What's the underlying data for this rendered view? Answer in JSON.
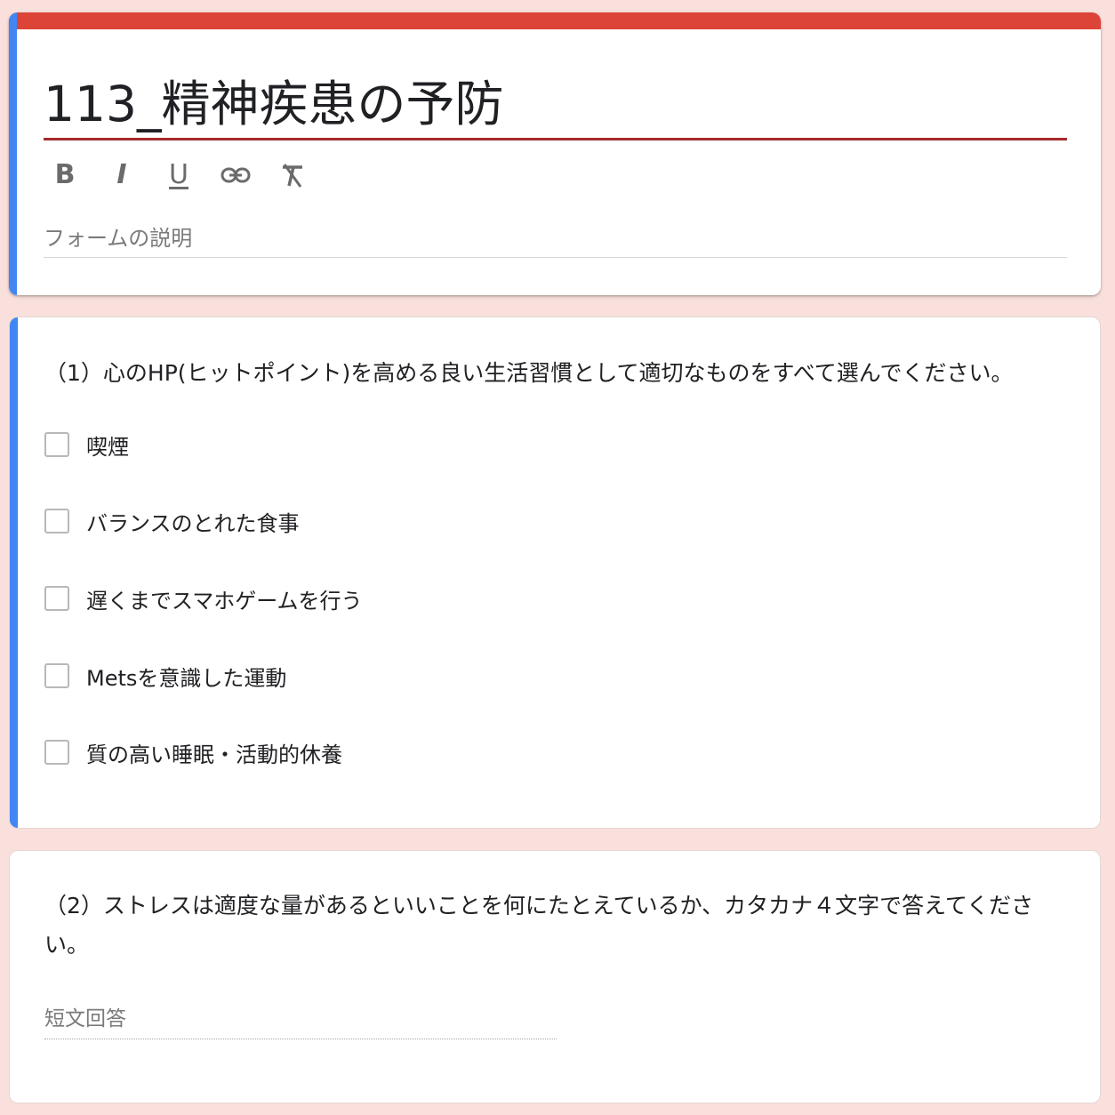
{
  "colors": {
    "background": "#fae0dc",
    "header_accent": "#db4437",
    "focus_accent": "#4285f4",
    "title_underline": "#a52a2a"
  },
  "form": {
    "title": "113_精神疾患の予防",
    "description_placeholder": "フォームの説明",
    "description_value": ""
  },
  "toolbar": {
    "bold_label": "B",
    "italic_label": "I",
    "underline_label": "U",
    "link_icon": "link-icon",
    "clear_format_icon": "format-clear-icon"
  },
  "questions": [
    {
      "text": "（1）心のHP(ヒットポイント)を高める良い生活習慣として適切なものをすべて選んでください。",
      "type": "checkbox",
      "options": [
        {
          "label": "喫煙",
          "checked": false
        },
        {
          "label": "バランスのとれた食事",
          "checked": false
        },
        {
          "label": "遅くまでスマホゲームを行う",
          "checked": false
        },
        {
          "label": "Metsを意識した運動",
          "checked": false
        },
        {
          "label": "質の高い睡眠・活動的休養",
          "checked": false
        }
      ]
    },
    {
      "text": "（2）ストレスは適度な量があるといいことを何にたとえているか、カタカナ４文字で答えてください。",
      "type": "short-answer",
      "placeholder": "短文回答",
      "value": ""
    }
  ]
}
